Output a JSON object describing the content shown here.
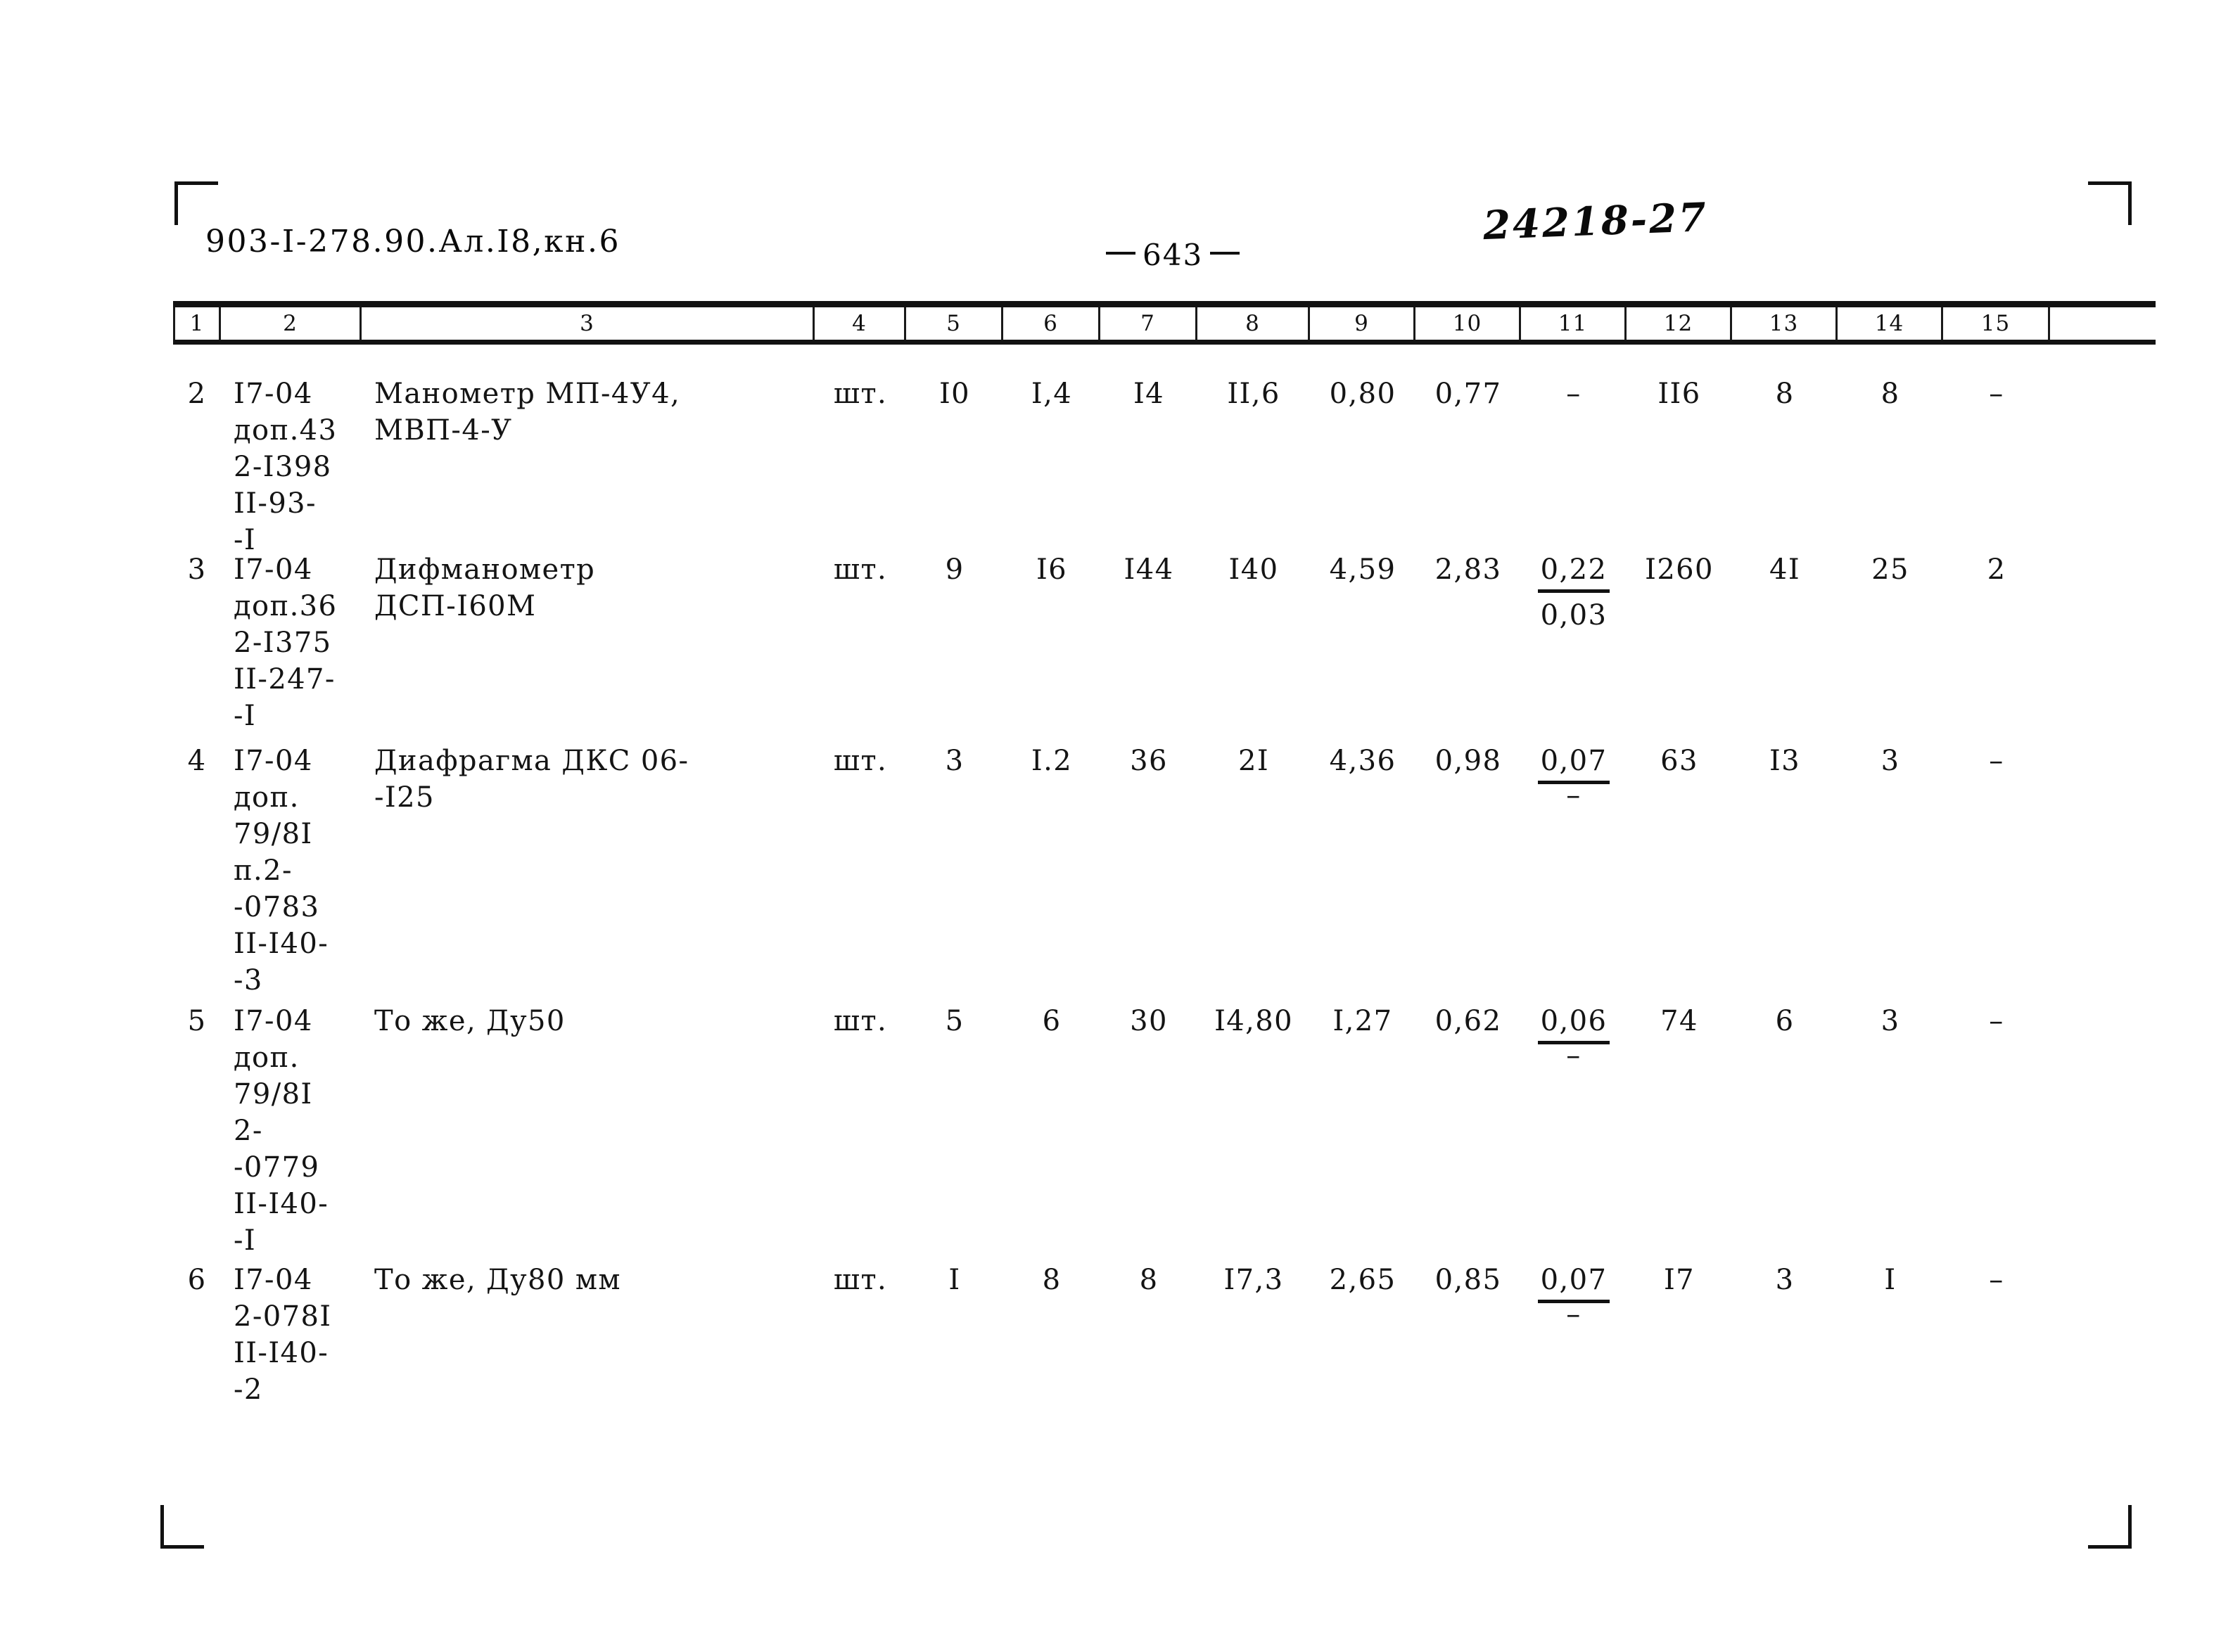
{
  "header": {
    "doc_code": "903-I-278.90.Ал.I8,кн.6",
    "page_number": "643",
    "hand_annotation": "24218-27"
  },
  "table": {
    "column_headers": [
      "1",
      "2",
      "3",
      "4",
      "5",
      "6",
      "7",
      "8",
      "9",
      "10",
      "11",
      "12",
      "13",
      "14",
      "15"
    ],
    "rows": [
      {
        "c1": "2",
        "c2": "I7-04\nдоп.43\n2-I398\nII-93-\n-I",
        "c3": "Манометр МП-4У4,\nМВП-4-У",
        "c4": "шт.",
        "c5": "I0",
        "c6": "I,4",
        "c7": "I4",
        "c8": "II,6",
        "c9": "0,80",
        "c10": "0,77",
        "c11_top": "–",
        "c11_bot": "",
        "c12": "II6",
        "c13": "8",
        "c14": "8",
        "c15": "–"
      },
      {
        "c1": "3",
        "c2": "I7-04\nдоп.36\n2-I375\nII-247-\n-I",
        "c3": "Дифманометр\nДСП-I60М",
        "c4": "шт.",
        "c5": "9",
        "c6": "I6",
        "c7": "I44",
        "c8": "I40",
        "c9": "4,59",
        "c10": "2,83",
        "c11_top": "0,22",
        "c11_bot": "0,03",
        "c12": "I260",
        "c13": "4I",
        "c14": "25",
        "c15": "2"
      },
      {
        "c1": "4",
        "c2": "I7-04\nдоп.\n79/8I\nп.2-\n-0783\nII-I40-\n-3",
        "c3": "Диафрагма ДКС 06-\n-I25",
        "c4": "шт.",
        "c5": "3",
        "c6": "I.2",
        "c7": "36",
        "c8": "2I",
        "c9": "4,36",
        "c10": "0,98",
        "c11_top": "0,07",
        "c11_bot": "–",
        "c12": "63",
        "c13": "I3",
        "c14": "3",
        "c15": "–"
      },
      {
        "c1": "5",
        "c2": "I7-04\nдоп.\n79/8I\n2-\n-0779\nII-I40-\n-I",
        "c3": "То же, Ду50",
        "c4": "шт.",
        "c5": "5",
        "c6": "6",
        "c7": "30",
        "c8": "I4,80",
        "c9": "I,27",
        "c10": "0,62",
        "c11_top": "0,06",
        "c11_bot": "–",
        "c12": "74",
        "c13": "6",
        "c14": "3",
        "c15": "–"
      },
      {
        "c1": "6",
        "c2": "I7-04\n2-078I\nII-I40-\n-2",
        "c3": "То же, Ду80 мм",
        "c4": "шт.",
        "c5": "I",
        "c6": "8",
        "c7": "8",
        "c8": "I7,3",
        "c9": "2,65",
        "c10": "0,85",
        "c11_top": "0,07",
        "c11_bot": "–",
        "c12": "I7",
        "c13": "3",
        "c14": "I",
        "c15": "–"
      }
    ]
  }
}
